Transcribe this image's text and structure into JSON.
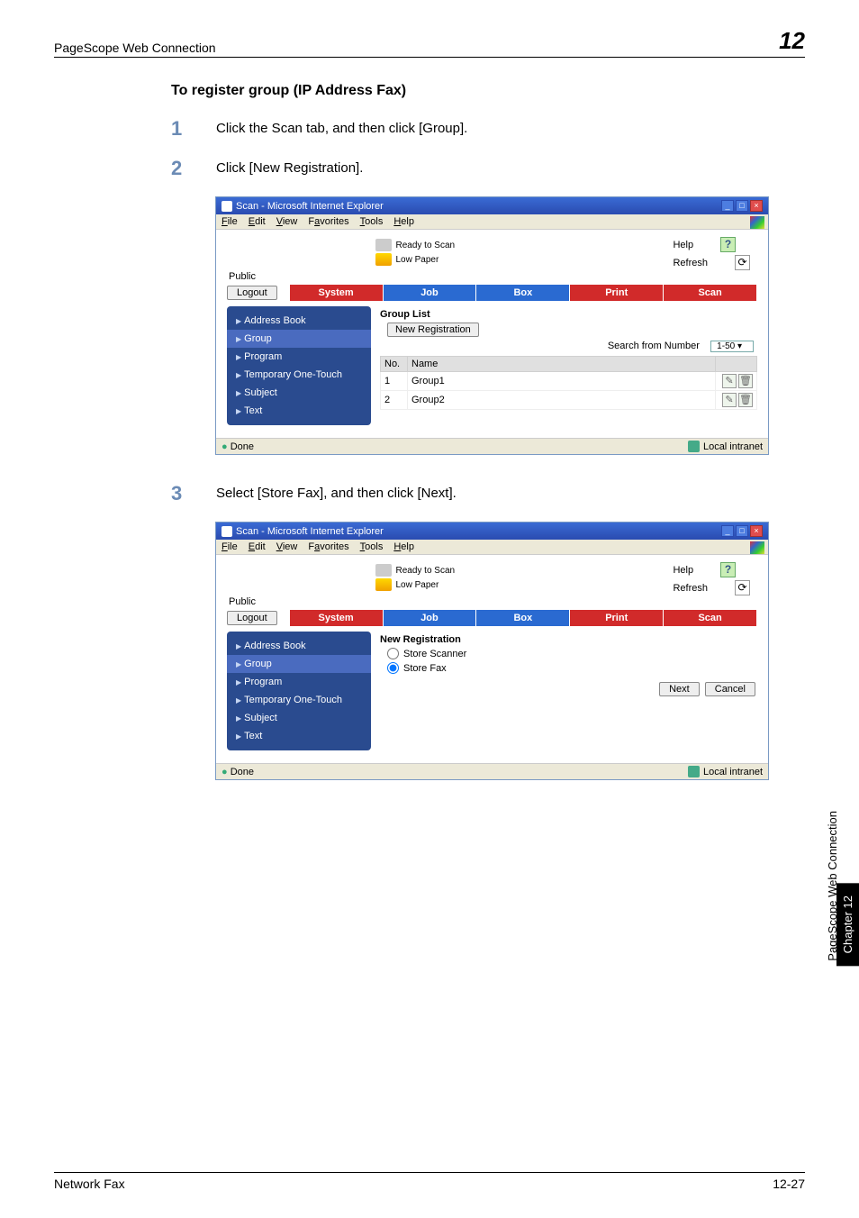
{
  "header": {
    "left": "PageScope Web Connection",
    "right": "12"
  },
  "section_title": "To register group (IP Address Fax)",
  "steps": {
    "s1": {
      "num": "1",
      "text": "Click the Scan tab, and then click [Group]."
    },
    "s2": {
      "num": "2",
      "text": "Click [New Registration]."
    },
    "s3": {
      "num": "3",
      "text": "Select [Store Fax], and then click [Next]."
    }
  },
  "ie": {
    "title": "Scan - Microsoft Internet Explorer",
    "menu": {
      "file": "File",
      "edit": "Edit",
      "view": "View",
      "favorites": "Favorites",
      "tools": "Tools",
      "help": "Help"
    },
    "status_done": "Done",
    "intranet": "Local intranet"
  },
  "pwc": {
    "status": {
      "ready": "Ready to Scan",
      "low": "Low Paper"
    },
    "help": "Help",
    "refresh": "Refresh",
    "public": "Public",
    "logout": "Logout",
    "tabs": {
      "system": "System",
      "job": "Job",
      "box": "Box",
      "print": "Print",
      "scan": "Scan"
    },
    "sidebar": {
      "address_book": "Address Book",
      "group": "Group",
      "program": "Program",
      "temp_one_touch": "Temporary One-Touch",
      "subject": "Subject",
      "text": "Text"
    }
  },
  "shot1": {
    "list_title": "Group List",
    "new_registration": "New Registration",
    "search_label": "Search from Number",
    "range": "1-50",
    "cols": {
      "no": "No.",
      "name": "Name"
    },
    "rows": [
      {
        "no": "1",
        "name": "Group1"
      },
      {
        "no": "2",
        "name": "Group2"
      }
    ]
  },
  "shot2": {
    "title": "New Registration",
    "opt_scanner": "Store Scanner",
    "opt_fax": "Store Fax",
    "next": "Next",
    "cancel": "Cancel"
  },
  "sidebar_text": {
    "rotated": "PageScope Web Connection",
    "tab": "Chapter 12"
  },
  "footer": {
    "left": "Network Fax",
    "right": "12-27"
  }
}
